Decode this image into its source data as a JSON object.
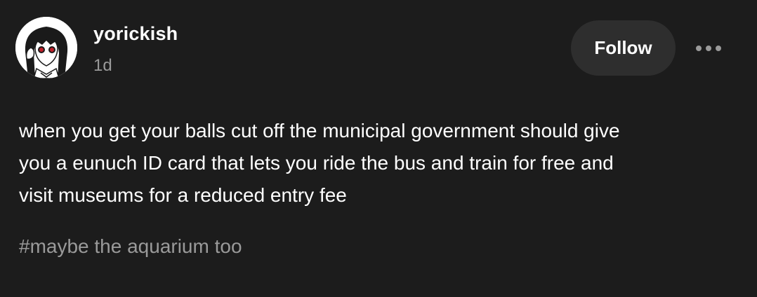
{
  "post": {
    "username": "yorickish",
    "timestamp": "1d",
    "follow_label": "Follow",
    "body_lines": [
      "when you get your balls cut off the municipal government should give",
      "you a eunuch ID card that lets you ride the bus and train for free and",
      "visit museums for a reduced entry fee"
    ],
    "tags": [
      "#maybe the aquarium too"
    ]
  },
  "icons": {
    "avatar": "anime-girl-avatar-icon",
    "more": "ellipsis-icon"
  },
  "colors": {
    "background": "#1c1c1c",
    "button": "#2e2e2e",
    "muted_text": "#9a9a9a",
    "text": "#ffffff"
  }
}
